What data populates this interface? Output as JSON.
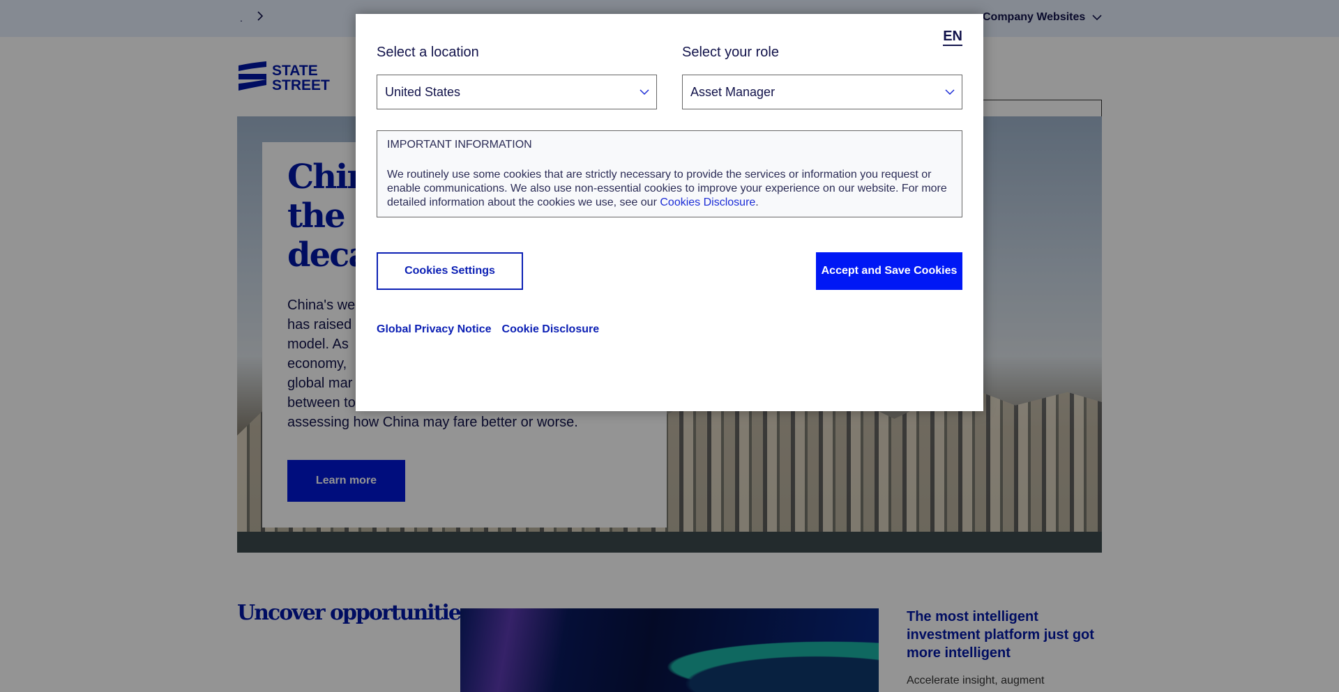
{
  "topbar": {
    "breadcrumb_dot": ".",
    "company_websites": "Company Websites"
  },
  "header": {
    "logo_text_line1": "STATE",
    "logo_text_line2": "STREET",
    "search_value": ""
  },
  "hero": {
    "title_lines": [
      "China",
      "the ec",
      "decad"
    ],
    "title": "China ... the ec... decad...",
    "body": "China's we... has raised... model. As... economy, ... global mar... between to... assessing how China may fare better or worse.",
    "body_lines": [
      "China's we",
      "has raised",
      "model. As",
      "economy,",
      "global mar",
      "between to",
      "assessing how China may fare better or worse."
    ],
    "learn_more": "Learn more"
  },
  "section": {
    "title": "Uncover opportunities",
    "promo_title": "The most intelligent investment platform just got more intelligent",
    "promo_text": "Accelerate insight, augment"
  },
  "modal": {
    "language": "EN",
    "location_label": "Select a location",
    "location_value": "United States",
    "role_label": "Select your role",
    "role_value": "Asset Manager",
    "info_heading": "IMPORTANT INFORMATION",
    "info_body_prefix": "We routinely use some cookies that are strictly necessary to provide the services or information you request or enable communications. We also use non-essential cookies to improve your experience on our website. For more detailed information about the cookies we use, see our ",
    "info_link": "Cookies Disclosure",
    "info_body_suffix": ".",
    "settings_button": "Cookies Settings",
    "accept_button": "Accept and Save Cookies",
    "privacy_link": "Global Privacy Notice",
    "cookie_link": "Cookie Disclosure"
  },
  "colors": {
    "brand_blue": "#0018a8",
    "accept_blue": "#0018f5",
    "link_blue": "#0b1fb4",
    "text_navy": "#11124a"
  }
}
